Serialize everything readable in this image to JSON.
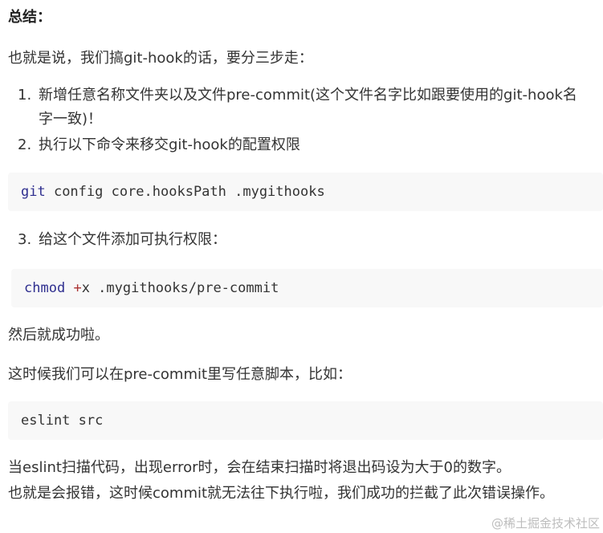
{
  "title": "总结：",
  "intro": "也就是说，我们搞git-hook的话，要分三步走：",
  "steps": [
    {
      "num": "1.",
      "text": "新增任意名称文件夹以及文件pre-commit(这个文件名字比如跟要使用的git-hook名字一致)！"
    },
    {
      "num": "2.",
      "text": "执行以下命令来移交git-hook的配置权限"
    },
    {
      "num": "3.",
      "text": "给这个文件添加可执行权限："
    }
  ],
  "code1": {
    "cmd": "git",
    "rest": " config core.hooksPath .mygithooks"
  },
  "code2": {
    "cmd": "chmod",
    "op": "+",
    "rest": "x .mygithooks/pre-commit"
  },
  "success": "然后就成功啦。",
  "write_hint": "这时候我们可以在pre-commit里写任意脚本，比如：",
  "code3": "eslint src",
  "explain_1": "当eslint扫描代码，出现error时，会在结束扫描时将退出码设为大于0的数字。",
  "explain_2": "也就是会报错，这时候commit就无法往下执行啦，我们成功的拦截了此次错误操作。",
  "watermark": "@稀土掘金技术社区"
}
